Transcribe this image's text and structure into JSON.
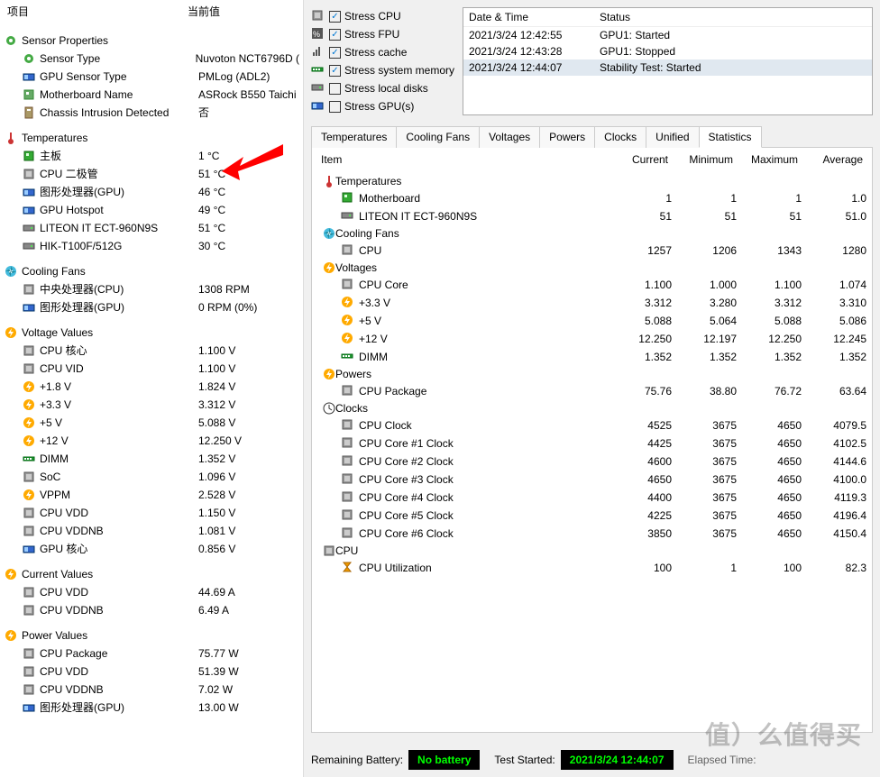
{
  "left": {
    "header": {
      "item": "项目",
      "value": "当前值"
    },
    "sections": [
      {
        "title": "Sensor Properties",
        "icon": "gear-green",
        "rows": [
          {
            "icon": "gear-green",
            "label": "Sensor Type",
            "value": "Nuvoton NCT6796D  ("
          },
          {
            "icon": "gpu",
            "label": "GPU Sensor Type",
            "value": "PMLog  (ADL2)"
          },
          {
            "icon": "mobo",
            "label": "Motherboard Name",
            "value": "ASRock B550 Taichi"
          },
          {
            "icon": "case",
            "label": "Chassis Intrusion Detected",
            "value": "否"
          }
        ]
      },
      {
        "title": "Temperatures",
        "icon": "thermo",
        "rows": [
          {
            "icon": "mobo-green",
            "label": "主板",
            "value": "1 °C"
          },
          {
            "icon": "chip-grey",
            "label": "CPU 二极管",
            "value": "51 °C"
          },
          {
            "icon": "gpu",
            "label": "图形处理器(GPU)",
            "value": "46 °C"
          },
          {
            "icon": "gpu",
            "label": "GPU Hotspot",
            "value": "49 °C"
          },
          {
            "icon": "drive",
            "label": "LITEON IT ECT-960N9S",
            "value": "51 °C"
          },
          {
            "icon": "drive",
            "label": "HIK-T100F/512G",
            "value": "30 °C"
          }
        ]
      },
      {
        "title": "Cooling Fans",
        "icon": "fan",
        "rows": [
          {
            "icon": "chip-grey",
            "label": "中央处理器(CPU)",
            "value": "1308 RPM"
          },
          {
            "icon": "gpu",
            "label": "图形处理器(GPU)",
            "value": "0 RPM  (0%)"
          }
        ]
      },
      {
        "title": "Voltage Values",
        "icon": "bolt",
        "rows": [
          {
            "icon": "chip-grey",
            "label": "CPU 核心",
            "value": "1.100 V"
          },
          {
            "icon": "chip-grey",
            "label": "CPU VID",
            "value": "1.100 V"
          },
          {
            "icon": "bolt",
            "label": "+1.8 V",
            "value": "1.824 V"
          },
          {
            "icon": "bolt",
            "label": "+3.3 V",
            "value": "3.312 V"
          },
          {
            "icon": "bolt",
            "label": "+5 V",
            "value": "5.088 V"
          },
          {
            "icon": "bolt",
            "label": "+12 V",
            "value": "12.250 V"
          },
          {
            "icon": "dimm",
            "label": "DIMM",
            "value": "1.352 V"
          },
          {
            "icon": "chip-grey",
            "label": "SoC",
            "value": "1.096 V"
          },
          {
            "icon": "bolt",
            "label": "VPPM",
            "value": "2.528 V"
          },
          {
            "icon": "chip-grey",
            "label": "CPU VDD",
            "value": "1.150 V"
          },
          {
            "icon": "chip-grey",
            "label": "CPU VDDNB",
            "value": "1.081 V"
          },
          {
            "icon": "gpu",
            "label": "GPU 核心",
            "value": "0.856 V"
          }
        ]
      },
      {
        "title": "Current Values",
        "icon": "bolt",
        "rows": [
          {
            "icon": "chip-grey",
            "label": "CPU VDD",
            "value": "44.69 A"
          },
          {
            "icon": "chip-grey",
            "label": "CPU VDDNB",
            "value": "6.49 A"
          }
        ]
      },
      {
        "title": "Power Values",
        "icon": "bolt",
        "rows": [
          {
            "icon": "chip-grey",
            "label": "CPU Package",
            "value": "75.77 W"
          },
          {
            "icon": "chip-grey",
            "label": "CPU VDD",
            "value": "51.39 W"
          },
          {
            "icon": "chip-grey",
            "label": "CPU VDDNB",
            "value": "7.02 W"
          },
          {
            "icon": "gpu",
            "label": "图形处理器(GPU)",
            "value": "13.00 W"
          }
        ]
      }
    ]
  },
  "stress": {
    "items": [
      {
        "icon": "chip-grey",
        "label": "Stress CPU",
        "checked": true
      },
      {
        "icon": "percent",
        "label": "Stress FPU",
        "checked": true
      },
      {
        "icon": "bars",
        "label": "Stress cache",
        "checked": true
      },
      {
        "icon": "dimm",
        "label": "Stress system memory",
        "checked": true
      },
      {
        "icon": "drive",
        "label": "Stress local disks",
        "checked": false
      },
      {
        "icon": "gpu",
        "label": "Stress GPU(s)",
        "checked": false
      }
    ]
  },
  "log": {
    "header": {
      "date": "Date & Time",
      "status": "Status"
    },
    "rows": [
      {
        "date": "2021/3/24 12:42:55",
        "status": "GPU1: Started",
        "selected": false
      },
      {
        "date": "2021/3/24 12:43:28",
        "status": "GPU1: Stopped",
        "selected": false
      },
      {
        "date": "2021/3/24 12:44:07",
        "status": "Stability Test: Started",
        "selected": true
      }
    ]
  },
  "tabs": [
    "Temperatures",
    "Cooling Fans",
    "Voltages",
    "Powers",
    "Clocks",
    "Unified",
    "Statistics"
  ],
  "active_tab": 6,
  "stats": {
    "header": {
      "item": "Item",
      "current": "Current",
      "min": "Minimum",
      "max": "Maximum",
      "avg": "Average"
    },
    "sections": [
      {
        "title": "Temperatures",
        "icon": "thermo",
        "rows": [
          {
            "icon": "mobo-green",
            "label": "Motherboard",
            "c": "1",
            "mn": "1",
            "mx": "1",
            "av": "1.0"
          },
          {
            "icon": "drive",
            "label": "LITEON IT ECT-960N9S",
            "c": "51",
            "mn": "51",
            "mx": "51",
            "av": "51.0"
          }
        ]
      },
      {
        "title": "Cooling Fans",
        "icon": "fan",
        "rows": [
          {
            "icon": "chip-grey",
            "label": "CPU",
            "c": "1257",
            "mn": "1206",
            "mx": "1343",
            "av": "1280"
          }
        ]
      },
      {
        "title": "Voltages",
        "icon": "bolt",
        "rows": [
          {
            "icon": "chip-grey",
            "label": "CPU Core",
            "c": "1.100",
            "mn": "1.000",
            "mx": "1.100",
            "av": "1.074"
          },
          {
            "icon": "bolt",
            "label": "+3.3 V",
            "c": "3.312",
            "mn": "3.280",
            "mx": "3.312",
            "av": "3.310"
          },
          {
            "icon": "bolt",
            "label": "+5 V",
            "c": "5.088",
            "mn": "5.064",
            "mx": "5.088",
            "av": "5.086"
          },
          {
            "icon": "bolt",
            "label": "+12 V",
            "c": "12.250",
            "mn": "12.197",
            "mx": "12.250",
            "av": "12.245"
          },
          {
            "icon": "dimm",
            "label": "DIMM",
            "c": "1.352",
            "mn": "1.352",
            "mx": "1.352",
            "av": "1.352"
          }
        ]
      },
      {
        "title": "Powers",
        "icon": "bolt",
        "rows": [
          {
            "icon": "chip-grey",
            "label": "CPU Package",
            "c": "75.76",
            "mn": "38.80",
            "mx": "76.72",
            "av": "63.64"
          }
        ]
      },
      {
        "title": "Clocks",
        "icon": "clock",
        "rows": [
          {
            "icon": "chip-grey",
            "label": "CPU Clock",
            "c": "4525",
            "mn": "3675",
            "mx": "4650",
            "av": "4079.5"
          },
          {
            "icon": "chip-grey",
            "label": "CPU Core #1 Clock",
            "c": "4425",
            "mn": "3675",
            "mx": "4650",
            "av": "4102.5"
          },
          {
            "icon": "chip-grey",
            "label": "CPU Core #2 Clock",
            "c": "4600",
            "mn": "3675",
            "mx": "4650",
            "av": "4144.6"
          },
          {
            "icon": "chip-grey",
            "label": "CPU Core #3 Clock",
            "c": "4650",
            "mn": "3675",
            "mx": "4650",
            "av": "4100.0"
          },
          {
            "icon": "chip-grey",
            "label": "CPU Core #4 Clock",
            "c": "4400",
            "mn": "3675",
            "mx": "4650",
            "av": "4119.3"
          },
          {
            "icon": "chip-grey",
            "label": "CPU Core #5 Clock",
            "c": "4225",
            "mn": "3675",
            "mx": "4650",
            "av": "4196.4"
          },
          {
            "icon": "chip-grey",
            "label": "CPU Core #6 Clock",
            "c": "3850",
            "mn": "3675",
            "mx": "4650",
            "av": "4150.4"
          }
        ]
      },
      {
        "title": "CPU",
        "icon": "chip-grey",
        "rows": [
          {
            "icon": "hourglass",
            "label": "CPU Utilization",
            "c": "100",
            "mn": "1",
            "mx": "100",
            "av": "82.3"
          }
        ]
      }
    ]
  },
  "status": {
    "battery_label": "Remaining Battery:",
    "battery_value": "No battery",
    "started_label": "Test Started:",
    "started_value": "2021/3/24 12:44:07",
    "elapsed_label": "Elapsed Time:"
  },
  "watermark": "值）么值得买"
}
